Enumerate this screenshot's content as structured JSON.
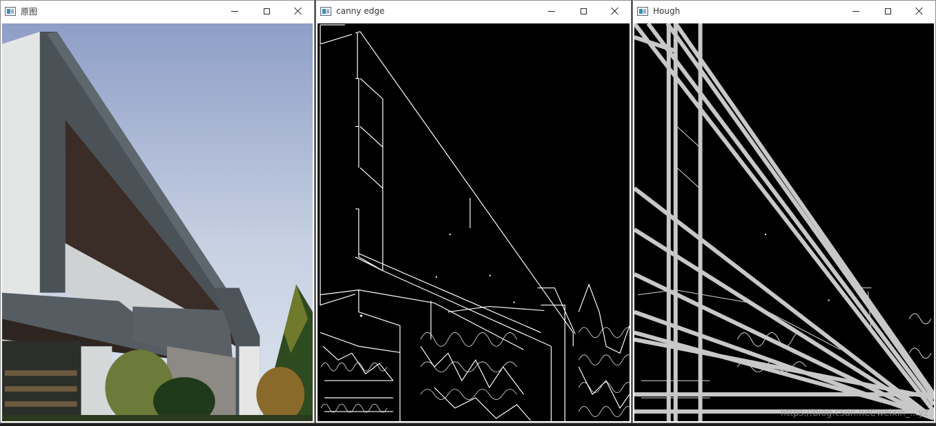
{
  "windows": [
    {
      "id": "original",
      "title": "原图"
    },
    {
      "id": "canny",
      "title": "canny edge"
    },
    {
      "id": "hough",
      "title": "Hough"
    }
  ],
  "controls": {
    "minimize": "minimize-icon",
    "maximize": "maximize-icon",
    "close": "close-icon"
  },
  "watermark": "https://blog.csdn.net/weixin_...yz",
  "colors": {
    "sky_top": "#8e9ec7",
    "sky_bottom": "#dde4ee",
    "edge": "#ffffff",
    "hough_line": "#c8c8c8",
    "bg": "#000000"
  }
}
